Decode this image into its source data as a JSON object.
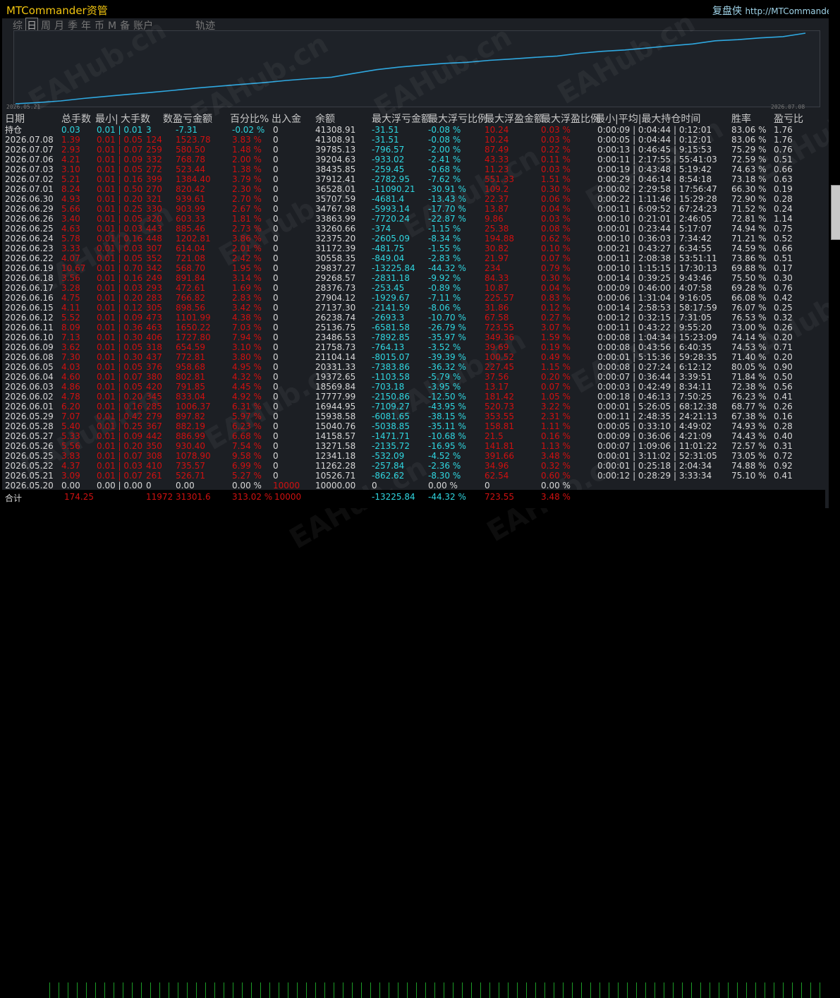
{
  "window": {
    "title": "MTCommander资管",
    "brand": "复盘侠",
    "url": "http://MTCommander.c"
  },
  "tabs": [
    "综",
    "日",
    "周",
    "月",
    "季",
    "年",
    "币",
    "M",
    "备",
    "账户",
    "轨迹"
  ],
  "active_tab": "日",
  "chart": {
    "start_date": "2026.05.21",
    "end_date": "2026.07.08",
    "line_color": "#2fa8e0"
  },
  "headers": [
    "日期",
    "总手数",
    "最小|",
    "大手数",
    "数",
    "盈亏金额",
    "百分比%",
    "出入金",
    "余额",
    "最大浮亏金额",
    "最大浮亏比例",
    "最大浮盈金额",
    "最大浮盈比例",
    "最小|平均|最大持仓时间",
    "胜率",
    "盈亏比"
  ],
  "holding": {
    "label": "持仓",
    "lots": "0.03",
    "minmax": "0.01 | 0.01",
    "count": "3",
    "pnl": "-7.31",
    "pct": "-0.02 %",
    "flow": "0",
    "balance": "41308.91",
    "maxloss": "-31.51",
    "maxlosspct": "-0.08 %",
    "maxprofit": "10.24",
    "maxprofitpct": "0.03 %",
    "hold": "0:00:09 | 0:04:44 | 0:12:01",
    "win": "83.06 %",
    "ratio": "1.76"
  },
  "rows": [
    [
      "2026.07.08",
      "1.39",
      "0.01 | 0.05",
      "124",
      "1523.78",
      "3.83 %",
      "0",
      "41308.91",
      "-31.51",
      "-0.08 %",
      "10.24",
      "0.03 %",
      "0:00:05 | 0:04:44 | 0:12:01",
      "83.06 %",
      "1.76"
    ],
    [
      "2026.07.07",
      "2.93",
      "0.01 | 0.07",
      "259",
      "580.50",
      "1.48 %",
      "0",
      "39785.13",
      "-796.57",
      "-2.00 %",
      "87.49",
      "0.22 %",
      "0:00:13 | 0:46:45 | 9:15:53",
      "75.29 %",
      "0.76"
    ],
    [
      "2026.07.06",
      "4.21",
      "0.01 | 0.09",
      "332",
      "768.78",
      "2.00 %",
      "0",
      "39204.63",
      "-933.02",
      "-2.41 %",
      "43.33",
      "0.11 %",
      "0:00:11 | 2:17:55 | 55:41:03",
      "72.59 %",
      "0.51"
    ],
    [
      "2026.07.03",
      "3.10",
      "0.01 | 0.05",
      "272",
      "523.44",
      "1.38 %",
      "0",
      "38435.85",
      "-259.45",
      "-0.68 %",
      "11.23",
      "0.03 %",
      "0:00:19 | 0:43:48 | 5:19:42",
      "74.63 %",
      "0.66"
    ],
    [
      "2026.07.02",
      "5.21",
      "0.01 | 0.16",
      "399",
      "1384.40",
      "3.79 %",
      "0",
      "37912.41",
      "-2782.95",
      "-7.62 %",
      "551.33",
      "1.51 %",
      "0:00:29 | 0:46:14 | 8:54:18",
      "73.18 %",
      "0.63"
    ],
    [
      "2026.07.01",
      "8.24",
      "0.01 | 0.50",
      "270",
      "820.42",
      "2.30 %",
      "0",
      "36528.01",
      "-11090.21",
      "-30.91 %",
      "109.2",
      "0.30 %",
      "0:00:02 | 2:29:58 | 17:56:47",
      "66.30 %",
      "0.19"
    ],
    [
      "2026.06.30",
      "4.93",
      "0.01 | 0.20",
      "321",
      "939.61",
      "2.70 %",
      "0",
      "35707.59",
      "-4681.4",
      "-13.43 %",
      "22.37",
      "0.06 %",
      "0:00:22 | 1:11:46 | 15:29:28",
      "72.90 %",
      "0.28"
    ],
    [
      "2026.06.29",
      "5.66",
      "0.01 | 0.25",
      "330",
      "903.99",
      "2.67 %",
      "0",
      "34767.98",
      "-5993.14",
      "-17.70 %",
      "13.87",
      "0.04 %",
      "0:00:11 | 6:09:52 | 67:24:23",
      "71.52 %",
      "0.24"
    ],
    [
      "2026.06.26",
      "3.40",
      "0.01 | 0.05",
      "320",
      "603.33",
      "1.81 %",
      "0",
      "33863.99",
      "-7720.24",
      "-22.87 %",
      "9.86",
      "0.03 %",
      "0:00:10 | 0:21:01 | 2:46:05",
      "72.81 %",
      "1.14"
    ],
    [
      "2026.06.25",
      "4.63",
      "0.01 | 0.03",
      "443",
      "885.46",
      "2.73 %",
      "0",
      "33260.66",
      "-374",
      "-1.15 %",
      "25.38",
      "0.08 %",
      "0:00:01 | 0:23:44 | 5:17:07",
      "74.94 %",
      "0.75"
    ],
    [
      "2026.06.24",
      "5.78",
      "0.01 | 0.16",
      "448",
      "1202.81",
      "3.86 %",
      "0",
      "32375.20",
      "-2605.09",
      "-8.34 %",
      "194.88",
      "0.62 %",
      "0:00:10 | 0:36:03 | 7:34:42",
      "71.21 %",
      "0.52"
    ],
    [
      "2026.06.23",
      "3.33",
      "0.01 | 0.03",
      "307",
      "614.04",
      "2.01 %",
      "0",
      "31172.39",
      "-481.75",
      "-1.55 %",
      "30.82",
      "0.10 %",
      "0:00:21 | 0:43:27 | 6:34:55",
      "74.59 %",
      "0.66"
    ],
    [
      "2026.06.22",
      "4.07",
      "0.01 | 0.05",
      "352",
      "721.08",
      "2.42 %",
      "0",
      "30558.35",
      "-849.04",
      "-2.83 %",
      "21.97",
      "0.07 %",
      "0:00:11 | 2:08:38 | 53:51:11",
      "73.86 %",
      "0.51"
    ],
    [
      "2026.06.19",
      "10.67",
      "0.01 | 0.70",
      "342",
      "568.70",
      "1.95 %",
      "0",
      "29837.27",
      "-13225.84",
      "-44.32 %",
      "234",
      "0.79 %",
      "0:00:10 | 1:15:15 | 17:30:13",
      "69.88 %",
      "0.17"
    ],
    [
      "2026.06.18",
      "3.56",
      "0.01 | 0.16",
      "249",
      "891.84",
      "3.14 %",
      "0",
      "29268.57",
      "-2831.18",
      "-9.92 %",
      "84.33",
      "0.30 %",
      "0:00:14 | 0:39:25 | 9:43:46",
      "75.50 %",
      "0.30"
    ],
    [
      "2026.06.17",
      "3.28",
      "0.01 | 0.03",
      "293",
      "472.61",
      "1.69 %",
      "0",
      "28376.73",
      "-253.45",
      "-0.89 %",
      "10.87",
      "0.04 %",
      "0:00:09 | 0:46:00 | 4:07:58",
      "69.28 %",
      "0.76"
    ],
    [
      "2026.06.16",
      "4.75",
      "0.01 | 0.20",
      "283",
      "766.82",
      "2.83 %",
      "0",
      "27904.12",
      "-1929.67",
      "-7.11 %",
      "225.57",
      "0.83 %",
      "0:00:06 | 1:31:04 | 9:16:05",
      "66.08 %",
      "0.42"
    ],
    [
      "2026.06.15",
      "4.11",
      "0.01 | 0.12",
      "305",
      "898.56",
      "3.42 %",
      "0",
      "27137.30",
      "-2141.59",
      "-8.06 %",
      "31.86",
      "0.12 %",
      "0:00:14 | 2:58:53 | 58:17:59",
      "76.07 %",
      "0.25"
    ],
    [
      "2026.06.12",
      "5.52",
      "0.01 | 0.09",
      "473",
      "1101.99",
      "4.38 %",
      "0",
      "26238.74",
      "-2693.3",
      "-10.70 %",
      "67.58",
      "0.27 %",
      "0:00:12 | 0:32:15 | 7:31:05",
      "76.53 %",
      "0.32"
    ],
    [
      "2026.06.11",
      "8.09",
      "0.01 | 0.36",
      "463",
      "1650.22",
      "7.03 %",
      "0",
      "25136.75",
      "-6581.58",
      "-26.79 %",
      "723.55",
      "3.07 %",
      "0:00:11 | 0:43:22 | 9:55:20",
      "73.00 %",
      "0.26"
    ],
    [
      "2026.06.10",
      "7.13",
      "0.01 | 0.30",
      "406",
      "1727.80",
      "7.94 %",
      "0",
      "23486.53",
      "-7892.85",
      "-35.97 %",
      "349.36",
      "1.59 %",
      "0:00:08 | 1:04:34 | 15:23:09",
      "74.14 %",
      "0.20"
    ],
    [
      "2026.06.09",
      "3.62",
      "0.01 | 0.05",
      "318",
      "654.59",
      "3.10 %",
      "0",
      "21758.73",
      "-764.13",
      "-3.52 %",
      "39.69",
      "0.19 %",
      "0:00:08 | 0:43:56 | 6:40:35",
      "74.53 %",
      "0.71"
    ],
    [
      "2026.06.08",
      "7.30",
      "0.01 | 0.30",
      "437",
      "772.81",
      "3.80 %",
      "0",
      "21104.14",
      "-8015.07",
      "-39.39 %",
      "100.52",
      "0.49 %",
      "0:00:01 | 5:15:36 | 59:28:35",
      "71.40 %",
      "0.20"
    ],
    [
      "2026.06.05",
      "4.03",
      "0.01 | 0.05",
      "376",
      "958.68",
      "4.95 %",
      "0",
      "20331.33",
      "-7383.86",
      "-36.32 %",
      "227.45",
      "1.15 %",
      "0:00:08 | 0:27:24 | 6:12:12",
      "80.05 %",
      "0.90"
    ],
    [
      "2026.06.04",
      "4.60",
      "0.01 | 0.07",
      "380",
      "802.81",
      "4.32 %",
      "0",
      "19372.65",
      "-1103.58",
      "-5.79 %",
      "37.56",
      "0.20 %",
      "0:00:07 | 0:36:44 | 3:39:51",
      "71.84 %",
      "0.50"
    ],
    [
      "2026.06.03",
      "4.86",
      "0.01 | 0.05",
      "420",
      "791.85",
      "4.45 %",
      "0",
      "18569.84",
      "-703.18",
      "-3.95 %",
      "13.17",
      "0.07 %",
      "0:00:03 | 0:42:49 | 8:34:11",
      "72.38 %",
      "0.56"
    ],
    [
      "2026.06.02",
      "4.78",
      "0.01 | 0.20",
      "345",
      "833.04",
      "4.92 %",
      "0",
      "17777.99",
      "-2150.86",
      "-12.50 %",
      "181.42",
      "1.05 %",
      "0:00:18 | 0:46:13 | 7:50:25",
      "76.23 %",
      "0.41"
    ],
    [
      "2026.06.01",
      "6.20",
      "0.01 | 0.16",
      "285",
      "1006.37",
      "6.31 %",
      "0",
      "16944.95",
      "-7109.27",
      "-43.95 %",
      "520.73",
      "3.22 %",
      "0:00:01 | 5:26:05 | 68:12:38",
      "68.77 %",
      "0.26"
    ],
    [
      "2026.05.29",
      "7.07",
      "0.01 | 0.42",
      "279",
      "897.82",
      "5.97 %",
      "0",
      "15938.58",
      "-6081.65",
      "-38.15 %",
      "353.55",
      "2.31 %",
      "0:00:11 | 2:48:35 | 24:21:13",
      "67.38 %",
      "0.16"
    ],
    [
      "2026.05.28",
      "5.40",
      "0.01 | 0.25",
      "367",
      "882.19",
      "6.23 %",
      "0",
      "15040.76",
      "-5038.85",
      "-35.11 %",
      "158.81",
      "1.11 %",
      "0:00:05 | 0:33:10 | 4:49:02",
      "74.93 %",
      "0.28"
    ],
    [
      "2026.05.27",
      "5.33",
      "0.01 | 0.09",
      "442",
      "886.99",
      "6.68 %",
      "0",
      "14158.57",
      "-1471.71",
      "-10.68 %",
      "21.5",
      "0.16 %",
      "0:00:09 | 0:36:06 | 4:21:09",
      "74.43 %",
      "0.40"
    ],
    [
      "2026.05.26",
      "5.56",
      "0.01 | 0.20",
      "350",
      "930.40",
      "7.54 %",
      "0",
      "13271.58",
      "-2135.72",
      "-16.95 %",
      "141.81",
      "1.13 %",
      "0:00:07 | 1:09:06 | 11:01:22",
      "72.57 %",
      "0.31"
    ],
    [
      "2026.05.25",
      "3.83",
      "0.01 | 0.07",
      "308",
      "1078.90",
      "9.58 %",
      "0",
      "12341.18",
      "-532.09",
      "-4.52 %",
      "391.66",
      "3.48 %",
      "0:00:01 | 3:11:02 | 52:31:05",
      "73.05 %",
      "0.72"
    ],
    [
      "2026.05.22",
      "4.37",
      "0.01 | 0.03",
      "410",
      "735.57",
      "6.99 %",
      "0",
      "11262.28",
      "-257.84",
      "-2.36 %",
      "34.96",
      "0.32 %",
      "0:00:01 | 0:25:18 | 2:04:34",
      "74.88 %",
      "0.92"
    ],
    [
      "2026.05.21",
      "3.09",
      "0.01 | 0.07",
      "261",
      "526.71",
      "5.27 %",
      "0",
      "10526.71",
      "-862.62",
      "-8.30 %",
      "62.54",
      "0.60 %",
      "0:00:12 | 0:28:29 | 3:33:34",
      "75.10 %",
      "0.41"
    ]
  ],
  "start_row": {
    "date": "2026.05.20",
    "lots": "0.00",
    "minmax": "0.00 | 0.00",
    "count": "0",
    "pnl": "0.00",
    "pct": "0.00 %",
    "flow": "10000",
    "balance": "10000.00",
    "maxloss": "0",
    "maxlosspct": "0.00 %",
    "maxprofit": "0",
    "maxprofitpct": "0.00 %"
  },
  "total_row": {
    "label": "合计",
    "lots": "174.25",
    "count_pnl": "11972 31301.6",
    "pct": "313.02 %",
    "flow": "10000",
    "maxloss": "-13225.84",
    "maxlosspct": "-44.32 %",
    "maxprofit": "723.55",
    "maxprofitpct": "3.48 %"
  },
  "watermark": "EAHub.cn",
  "colors": {
    "gain": "#d01010",
    "cyan": "#2fd6e0",
    "title": "#f1c40f",
    "text": "#d8d8d8"
  }
}
